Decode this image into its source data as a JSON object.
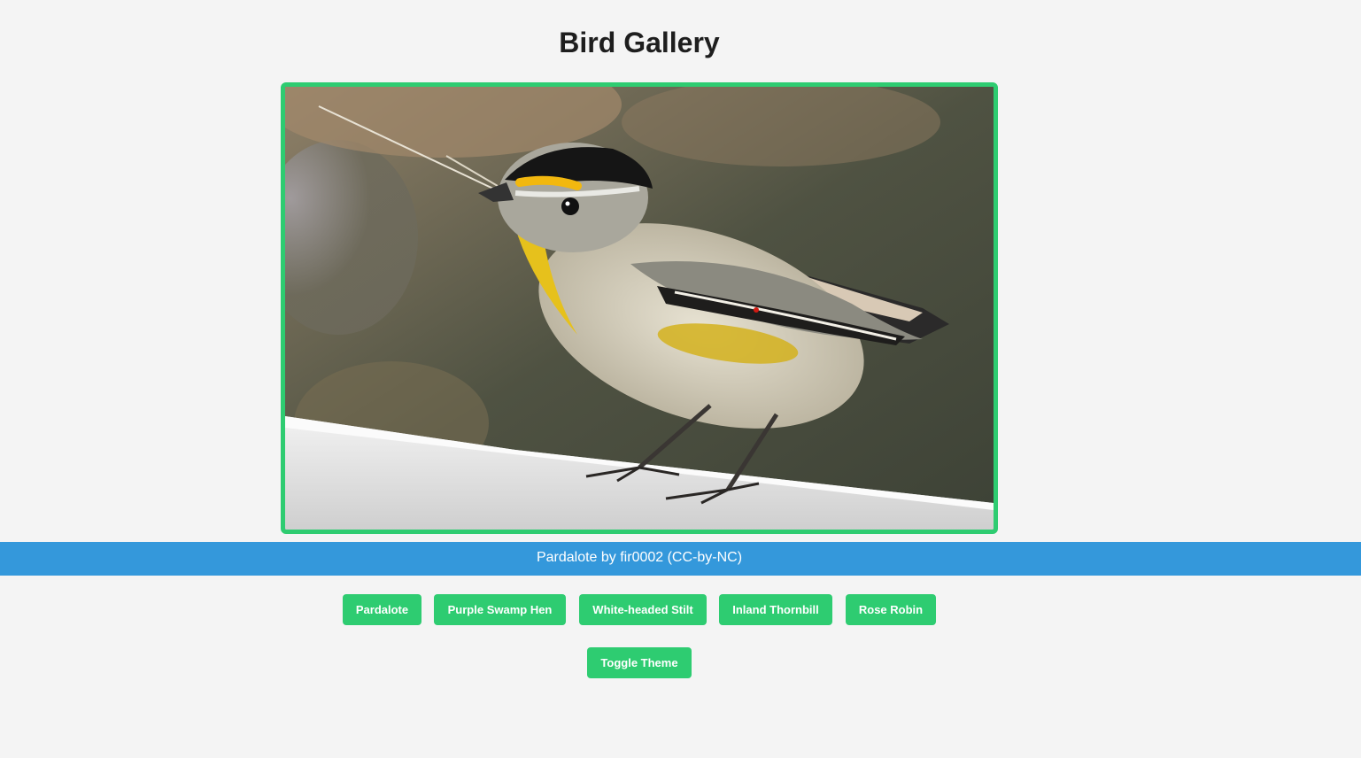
{
  "page": {
    "title": "Bird Gallery"
  },
  "photo": {
    "alt": "Pardalote"
  },
  "caption": {
    "text": "Pardalote by fir0002 (CC-by-NC)"
  },
  "bird_buttons": [
    {
      "label": "Pardalote"
    },
    {
      "label": "Purple Swamp Hen"
    },
    {
      "label": "White-headed Stilt"
    },
    {
      "label": "Inland Thornbill"
    },
    {
      "label": "Rose Robin"
    }
  ],
  "theme_button": {
    "label": "Toggle Theme"
  },
  "colors": {
    "accent": "#2ecc71",
    "caption_bg": "#3498db",
    "page_bg": "#f4f4f4"
  }
}
